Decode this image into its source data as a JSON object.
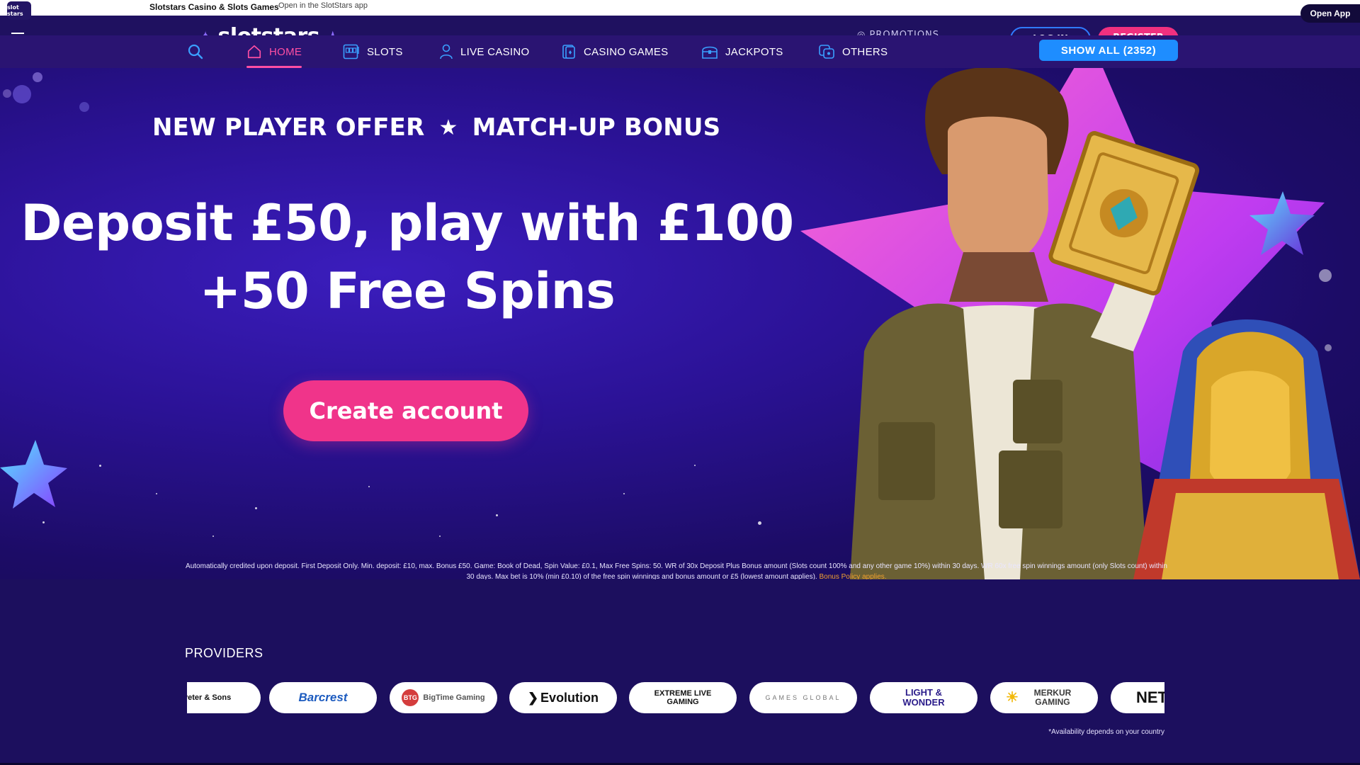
{
  "app_banner": {
    "title": "Slotstars Casino & Slots Games",
    "subtitle": "Open in the SlotStars app",
    "open_button": "Open App",
    "icon_text": "slot stars"
  },
  "header": {
    "logo": "slotstars",
    "promotions": "PROMOTIONS",
    "login": "LOG IN",
    "register": "REGISTER"
  },
  "nav": {
    "items": [
      {
        "label": "HOME",
        "icon": "home-icon",
        "active": true
      },
      {
        "label": "SLOTS",
        "icon": "slot-machine-icon",
        "active": false
      },
      {
        "label": "LIVE CASINO",
        "icon": "person-icon",
        "active": false
      },
      {
        "label": "CASINO GAMES",
        "icon": "cards-icon",
        "active": false
      },
      {
        "label": "JACKPOTS",
        "icon": "treasure-icon",
        "active": false
      },
      {
        "label": "OTHERS",
        "icon": "others-icon",
        "active": false
      }
    ],
    "show_all": "SHOW ALL (2352)"
  },
  "hero": {
    "offer_left": "NEW PLAYER OFFER",
    "offer_right": "MATCH-UP BONUS",
    "headline_line1": "Deposit £50, play with £100",
    "headline_line2": "+50 Free Spins",
    "cta": "Create account",
    "terms_line1": "Automatically credited upon deposit. First Deposit Only. Min. deposit: £10, max. Bonus £50. Game: Book of Dead, Spin Value: £0.1, Max Free Spins: 50. WR of 30x Deposit Plus Bonus amount (Slots count 100% and any other game 10%) within 30 days. WR 60x free spin winnings amount (only Slots count) within",
    "terms_line2": "30 days. Max bet is 10% (min £0.10) of the free spin winnings and bonus amount or £5 (lowest amount applies).",
    "terms_link": "Bonus Policy applies."
  },
  "providers": {
    "title": "PROVIDERS",
    "items": [
      "Peter & Sons",
      "Barcrest",
      "BigTime Gaming",
      "Evolution",
      "EXTREME LIVE GAMING",
      "GAMES GLOBAL",
      "LIGHT & WONDER",
      "MERKUR GAMING",
      "NET"
    ],
    "availability": "*Availability depends on your country"
  },
  "colors": {
    "accent_pink": "#f0348a",
    "accent_blue": "#1e8dff",
    "nav_bg": "#2a1472",
    "page_bg": "#1c0f5e"
  }
}
